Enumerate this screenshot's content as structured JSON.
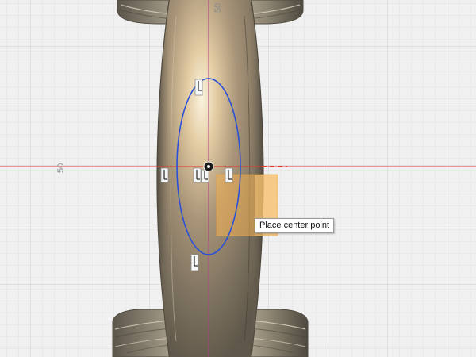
{
  "viewport": {
    "background_color": "#f0f0f0",
    "minor_grid_color": "#e2e2e2",
    "major_grid_color": "#cdcdcd",
    "x_axis_color": "#e03a2f",
    "y_axis_color": "#c2309a",
    "sketch_color": "#2b50d8",
    "axis_labels": {
      "top": "50",
      "left": "50"
    }
  },
  "sketch": {
    "tool": "Ellipse",
    "constraint_icons": [
      "horizontal-constraint-icon",
      "vertical-constraint-icon",
      "coincident-constraint-icon"
    ]
  },
  "tooltip": {
    "text": "Place center point"
  }
}
